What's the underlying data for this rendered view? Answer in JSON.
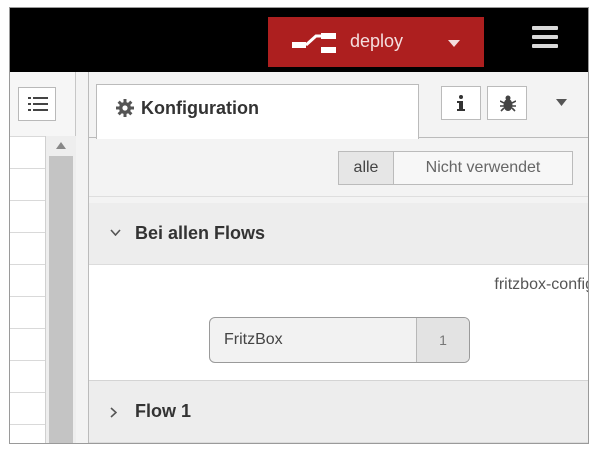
{
  "header": {
    "deploy_label": "deploy",
    "deploy_color": "#ad1f1f",
    "menu_icon": "hamburger-icon"
  },
  "palette": {
    "list_icon": "list-icon"
  },
  "sidebar": {
    "active_tab": {
      "icon": "gear-icon",
      "label": "Konfiguration"
    },
    "icon_buttons": [
      {
        "icon": "info-icon"
      },
      {
        "icon": "bug-icon"
      }
    ],
    "filter": {
      "all_label": "alle",
      "unused_label": "Nicht verwendet",
      "selected": "alle"
    },
    "sections": [
      {
        "label": "Bei allen Flows",
        "expanded": true,
        "type_label": "fritzbox-config",
        "nodes": [
          {
            "name": "FritzBox",
            "count": "1"
          }
        ]
      },
      {
        "label": "Flow 1",
        "expanded": false
      }
    ]
  }
}
